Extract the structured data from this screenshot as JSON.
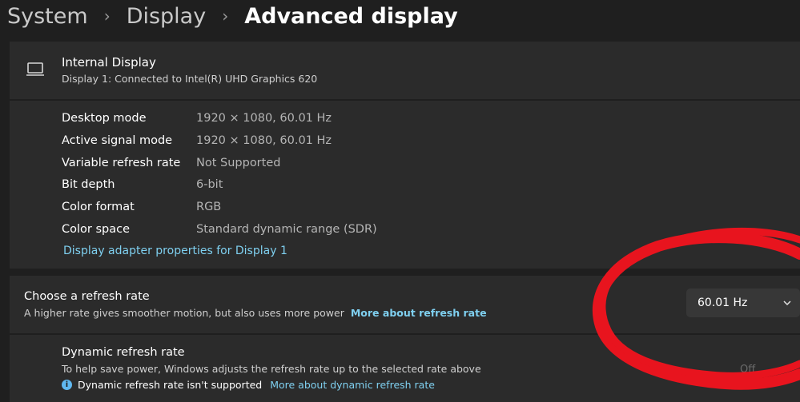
{
  "breadcrumb": {
    "items": [
      "System",
      "Display"
    ],
    "current": "Advanced display"
  },
  "display_header": {
    "title": "Internal Display",
    "subtitle": "Display 1: Connected to Intel(R) UHD Graphics 620",
    "icon": "monitor-icon"
  },
  "display_details": {
    "rows": [
      {
        "label": "Desktop mode",
        "value": "1920 × 1080, 60.01 Hz"
      },
      {
        "label": "Active signal mode",
        "value": "1920 × 1080, 60.01 Hz"
      },
      {
        "label": "Variable refresh rate",
        "value": "Not Supported"
      },
      {
        "label": "Bit depth",
        "value": "6-bit"
      },
      {
        "label": "Color format",
        "value": "RGB"
      },
      {
        "label": "Color space",
        "value": "Standard dynamic range (SDR)"
      }
    ],
    "adapter_link": "Display adapter properties for Display 1"
  },
  "refresh_rate": {
    "title": "Choose a refresh rate",
    "description": "A higher rate gives smoother motion, but also uses more power",
    "link": "More about refresh rate",
    "selected": "60.01 Hz"
  },
  "dynamic_refresh": {
    "title": "Dynamic refresh rate",
    "description": "To help save power, Windows adjusts the refresh rate up to the selected rate above",
    "note": "Dynamic refresh rate isn't supported",
    "link": "More about dynamic refresh rate",
    "toggle_label": "Off"
  },
  "colors": {
    "background": "#1f1f1f",
    "card": "#2b2b2b",
    "link": "#7fd0f0",
    "annotation": "#e8141e"
  }
}
